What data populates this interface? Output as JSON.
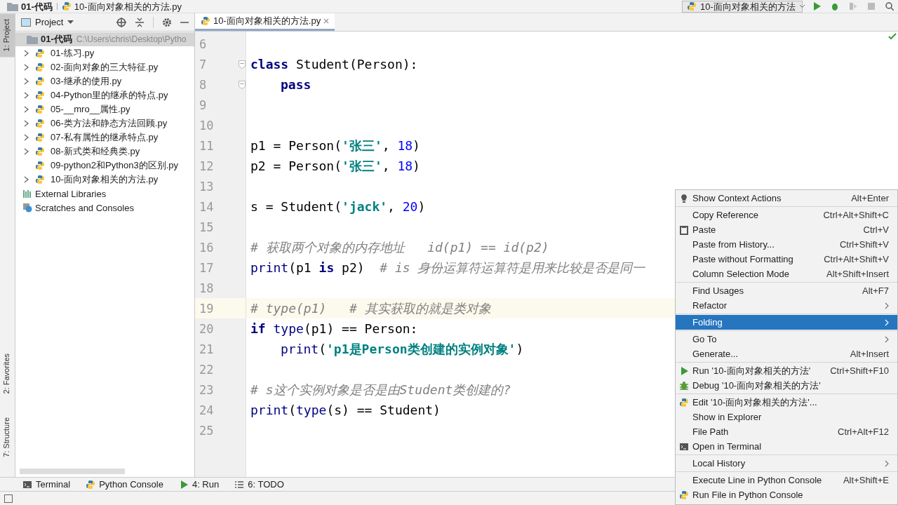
{
  "navbar": {
    "breadcrumbs": [
      "01-代码",
      "10-面向对象相关的方法.py"
    ],
    "run_config": "10-面向对象相关的方法"
  },
  "side_stripe": [
    {
      "label": "1: Project",
      "selected": true,
      "kind": "top"
    },
    {
      "label": "2: Favorites",
      "selected": false,
      "kind": "bottom"
    },
    {
      "label": "7: Structure",
      "selected": false,
      "kind": "bottom"
    }
  ],
  "project_panel": {
    "title": "Project",
    "root": {
      "name": "01-代码",
      "path": "C:\\Users\\chris\\Desktop\\Pytho",
      "children": [
        {
          "name": "01-练习.py",
          "expandable": true
        },
        {
          "name": "02-面向对象的三大特征.py",
          "expandable": true
        },
        {
          "name": "03-继承的使用.py",
          "expandable": true
        },
        {
          "name": "04-Python里的继承的特点.py",
          "expandable": true
        },
        {
          "name": "05-__mro__属性.py",
          "expandable": true
        },
        {
          "name": "06-类方法和静态方法回顾.py",
          "expandable": true
        },
        {
          "name": "07-私有属性的继承特点.py",
          "expandable": true
        },
        {
          "name": "08-新式类和经典类.py",
          "expandable": true
        },
        {
          "name": "09-python2和Python3的区别.py",
          "expandable": false
        },
        {
          "name": "10-面向对象相关的方法.py",
          "expandable": true
        }
      ]
    },
    "extras": [
      {
        "name": "External Libraries",
        "kind": "libraries"
      },
      {
        "name": "Scratches and Consoles",
        "kind": "scratches"
      }
    ]
  },
  "editor": {
    "tabs": [
      {
        "label": "10-面向对象相关的方法.py",
        "selected": true
      }
    ],
    "lines": [
      {
        "number": "6",
        "current": false,
        "fold": false
      },
      {
        "number": "7",
        "current": false,
        "fold": true,
        "indented": false,
        "tokens": [
          {
            "kind": "kw",
            "text": "class"
          },
          {
            "kind": "text",
            "text": " Student(Person):"
          }
        ]
      },
      {
        "number": "8",
        "current": false,
        "fold": true,
        "indented": true,
        "tokens": [
          {
            "kind": "kw",
            "text": "pass"
          }
        ]
      },
      {
        "number": "9",
        "current": false,
        "fold": false
      },
      {
        "number": "10",
        "current": false,
        "fold": false
      },
      {
        "number": "11",
        "current": false,
        "fold": false,
        "indented": false,
        "tokens": [
          {
            "kind": "text",
            "text": "p1 = Person("
          },
          {
            "kind": "str",
            "text": "'张三'"
          },
          {
            "kind": "text",
            "text": ", "
          },
          {
            "kind": "num",
            "text": "18"
          },
          {
            "kind": "text",
            "text": ")"
          }
        ]
      },
      {
        "number": "12",
        "current": false,
        "fold": false,
        "indented": false,
        "tokens": [
          {
            "kind": "text",
            "text": "p2 = Person("
          },
          {
            "kind": "str",
            "text": "'张三'"
          },
          {
            "kind": "text",
            "text": ", "
          },
          {
            "kind": "num",
            "text": "18"
          },
          {
            "kind": "text",
            "text": ")"
          }
        ]
      },
      {
        "number": "13",
        "current": false,
        "fold": false
      },
      {
        "number": "14",
        "current": false,
        "fold": false,
        "indented": false,
        "tokens": [
          {
            "kind": "text",
            "text": "s = Student("
          },
          {
            "kind": "str",
            "text": "'jack'"
          },
          {
            "kind": "text",
            "text": ", "
          },
          {
            "kind": "num",
            "text": "20"
          },
          {
            "kind": "text",
            "text": ")"
          }
        ]
      },
      {
        "number": "15",
        "current": false,
        "fold": false
      },
      {
        "number": "16",
        "current": false,
        "fold": false,
        "indented": false,
        "tokens": [
          {
            "kind": "comment",
            "text": "# 获取两个对象的内存地址   id(p1) == id(p2)"
          }
        ]
      },
      {
        "number": "17",
        "current": false,
        "fold": false,
        "indented": false,
        "tokens": [
          {
            "kind": "builtin",
            "text": "print"
          },
          {
            "kind": "text",
            "text": "(p1 "
          },
          {
            "kind": "kw",
            "text": "is"
          },
          {
            "kind": "text",
            "text": " p2)  "
          },
          {
            "kind": "comment",
            "text": "# is 身份运算符运算符是用来比较是否是同一"
          }
        ]
      },
      {
        "number": "18",
        "current": false,
        "fold": false
      },
      {
        "number": "19",
        "current": true,
        "fold": false,
        "indented": false,
        "tokens": [
          {
            "kind": "comment",
            "text": "# type(p1)   # 其实获取的就是类对象"
          }
        ]
      },
      {
        "number": "20",
        "current": false,
        "fold": false,
        "indented": false,
        "tokens": [
          {
            "kind": "kw",
            "text": "if"
          },
          {
            "kind": "builtin",
            "text": " type"
          },
          {
            "kind": "text",
            "text": "(p1) == Person:"
          }
        ]
      },
      {
        "number": "21",
        "current": false,
        "fold": false,
        "indented": true,
        "tokens": [
          {
            "kind": "builtin",
            "text": "print"
          },
          {
            "kind": "text",
            "text": "("
          },
          {
            "kind": "str",
            "text": "'p1是Person类创建的实例对象'"
          },
          {
            "kind": "text",
            "text": ")"
          }
        ]
      },
      {
        "number": "22",
        "current": false,
        "fold": false
      },
      {
        "number": "23",
        "current": false,
        "fold": false,
        "indented": false,
        "tokens": [
          {
            "kind": "comment",
            "text": "# s这个实例对象是否是由Student类创建的?"
          }
        ]
      },
      {
        "number": "24",
        "current": false,
        "fold": false,
        "indented": false,
        "tokens": [
          {
            "kind": "builtin",
            "text": "print"
          },
          {
            "kind": "text",
            "text": "("
          },
          {
            "kind": "builtin",
            "text": "type"
          },
          {
            "kind": "text",
            "text": "(s) == Student)"
          }
        ]
      },
      {
        "number": "25",
        "current": false,
        "fold": false
      }
    ]
  },
  "context_menu": {
    "groups": [
      [
        {
          "label": "Show Context Actions",
          "shortcut": "Alt+Enter",
          "kind": "bulb",
          "submenu": false,
          "selected": false
        }
      ],
      [
        {
          "label": "Copy Reference",
          "shortcut": "Ctrl+Alt+Shift+C",
          "kind": "plain",
          "submenu": false,
          "selected": false
        },
        {
          "label": "Paste",
          "shortcut": "Ctrl+V",
          "kind": "clipboard",
          "submenu": false,
          "selected": false
        },
        {
          "label": "Paste from History...",
          "shortcut": "Ctrl+Shift+V",
          "kind": "plain",
          "submenu": false,
          "selected": false
        },
        {
          "label": "Paste without Formatting",
          "shortcut": "Ctrl+Alt+Shift+V",
          "kind": "plain",
          "submenu": false,
          "selected": false
        },
        {
          "label": "Column Selection Mode",
          "shortcut": "Alt+Shift+Insert",
          "kind": "plain",
          "submenu": false,
          "selected": false
        }
      ],
      [
        {
          "label": "Find Usages",
          "shortcut": "Alt+F7",
          "kind": "plain",
          "submenu": false,
          "selected": false
        },
        {
          "label": "Refactor",
          "kind": "plain",
          "submenu": true,
          "selected": false
        }
      ],
      [
        {
          "label": "Folding",
          "kind": "plain",
          "submenu": true,
          "selected": true
        }
      ],
      [
        {
          "label": "Go To",
          "kind": "plain",
          "submenu": true,
          "selected": false
        },
        {
          "label": "Generate...",
          "shortcut": "Alt+Insert",
          "kind": "plain",
          "submenu": false,
          "selected": false
        }
      ],
      [
        {
          "label": "Run '10-面向对象相关的方法'",
          "shortcut": "Ctrl+Shift+F10",
          "kind": "run",
          "submenu": false,
          "selected": false
        },
        {
          "label": "Debug '10-面向对象相关的方法'",
          "kind": "debug",
          "submenu": false,
          "selected": false
        }
      ],
      [
        {
          "label": "Edit '10-面向对象相关的方法'...",
          "kind": "python",
          "submenu": false,
          "selected": false
        },
        {
          "label": "Show in Explorer",
          "kind": "plain",
          "submenu": false,
          "selected": false
        },
        {
          "label": "File Path",
          "shortcut": "Ctrl+Alt+F12",
          "kind": "plain",
          "submenu": false,
          "selected": false
        },
        {
          "label": "Open in Terminal",
          "kind": "terminal",
          "submenu": false,
          "selected": false
        }
      ],
      [
        {
          "label": "Local History",
          "kind": "plain",
          "submenu": true,
          "selected": false
        }
      ],
      [
        {
          "label": "Execute Line in Python Console",
          "shortcut": "Alt+Shift+E",
          "kind": "plain",
          "submenu": false,
          "selected": false
        },
        {
          "label": "Run File in Python Console",
          "kind": "python",
          "submenu": false,
          "selected": false
        }
      ]
    ]
  },
  "tool_windows": [
    {
      "label": "Terminal",
      "kind": "terminal"
    },
    {
      "label": "Python Console",
      "kind": "python"
    },
    {
      "label": "4: Run",
      "kind": "run"
    },
    {
      "label": "6: TODO",
      "kind": "todo"
    }
  ]
}
